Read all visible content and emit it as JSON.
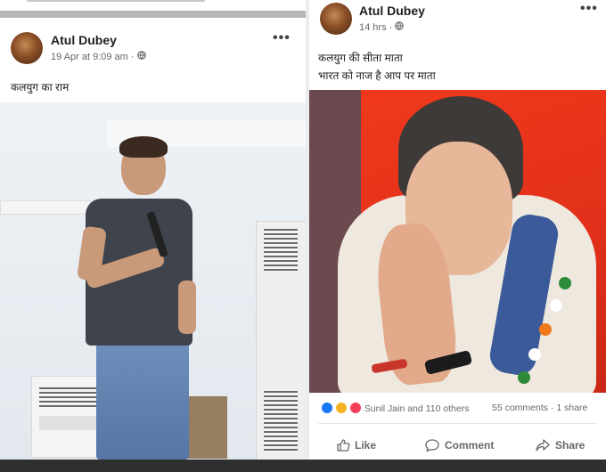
{
  "left_post": {
    "author": "Atul Dubey",
    "timestamp": "19 Apr at 9:09 am",
    "privacy_icon": "globe-icon",
    "menu_icon": "more-icon",
    "text": "कलयुग का राम"
  },
  "right_post": {
    "author": "Atul Dubey",
    "timestamp": "14 hrs",
    "privacy_icon": "globe-icon",
    "menu_icon": "more-icon",
    "text_line1": "कलयुग की सीता माता",
    "text_line2": "भारत को नाज है आप पर माता",
    "reactions_summary": "Sunil Jain and 110 others",
    "comments_count": "55 comments",
    "shares_count": "1 share",
    "actions": {
      "like": "Like",
      "comment": "Comment",
      "share": "Share"
    }
  },
  "colors": {
    "accent": "#1877f2",
    "text_secondary": "#65676b",
    "red_backdrop": "#e2301a"
  }
}
